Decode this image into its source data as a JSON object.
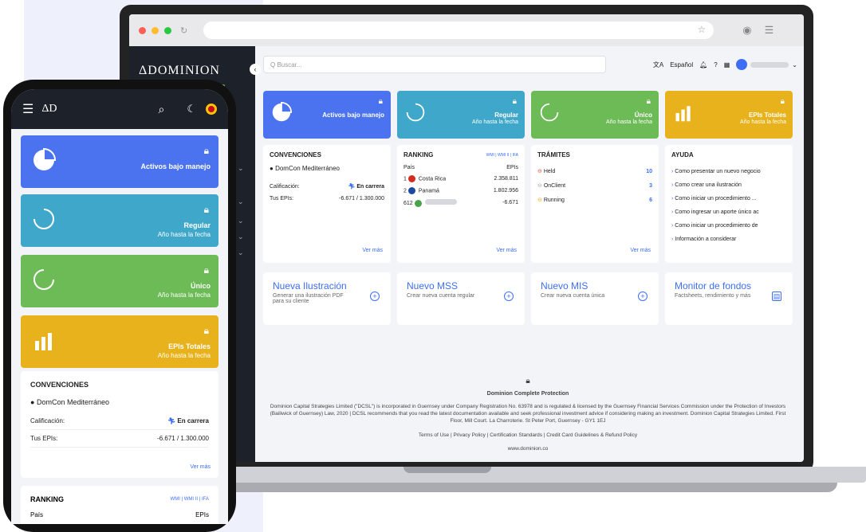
{
  "app": {
    "logo": "ΔDOMINION",
    "phone_logo": "ΔD"
  },
  "search": {
    "placeholder": "Q Buscar..."
  },
  "topbar": {
    "language": "Español"
  },
  "kpis": [
    {
      "title": "Activos bajo manejo",
      "subtitle": "",
      "color": "#4b73f0"
    },
    {
      "title": "Regular",
      "subtitle": "Año hasta la fecha",
      "color": "#3fa7c9"
    },
    {
      "title": "Único",
      "subtitle": "Año hasta la fecha",
      "color": "#6dbb57"
    },
    {
      "title": "EPIs Totales",
      "subtitle": "Año hasta la fecha",
      "color": "#e8b21c"
    }
  ],
  "convenciones": {
    "title": "CONVENCIONES",
    "name": "DomCon Mediterráneo",
    "calificacion_label": "Calificación:",
    "calificacion_value": "En carrera",
    "epis_label": "Tus EPIs:",
    "epis_value": "-6.671 / 1.300.000",
    "ver_mas": "Ver más"
  },
  "ranking": {
    "title": "RANKING",
    "tabs": "WMI | WMI II | IFA",
    "col_pais": "País",
    "col_epis": "EPIs",
    "rows": [
      {
        "rank": "1",
        "country": "Costa Rica",
        "value": "2.358.811"
      },
      {
        "rank": "2",
        "country": "Panamá",
        "value": "1.802.956"
      },
      {
        "rank": "612",
        "country": "",
        "value": "-6.671"
      }
    ],
    "ver_mas": "Ver más"
  },
  "tramites": {
    "title": "TRÁMITES",
    "rows": [
      {
        "label": "Held",
        "count": "10"
      },
      {
        "label": "OnClient",
        "count": "3"
      },
      {
        "label": "Running",
        "count": "6"
      }
    ],
    "ver_mas": "Ver más"
  },
  "ayuda": {
    "title": "AYUDA",
    "items": [
      "Como presentar un nuevo negocio",
      "Como crear una ilustración",
      "Como iniciar un procedimiento ...",
      "Como ingresar un aporte único ac",
      "Como iniciar un procedimiento de",
      "Información a considerar"
    ]
  },
  "actions": [
    {
      "title": "Nueva Ilustración",
      "subtitle": "Generar una ilustración PDF para su cliente"
    },
    {
      "title": "Nuevo MSS",
      "subtitle": "Crear nueva cuenta regular"
    },
    {
      "title": "Nuevo MIS",
      "subtitle": "Crear nueva cuenta única"
    },
    {
      "title": "Monitor de fondos",
      "subtitle": "Factsheets, rendimiento y más"
    }
  ],
  "footer": {
    "title": "Dominion Complete Protection",
    "legal": "Dominion Capital Strategies Limited (\"DCSL\") is incorporated in Guernsey under Company Registration No. 63978 and is regulated & licensed by the Guernsey Financial Services Commission under the Protection of Investors (Bailiwick of Guernsey) Law, 2020 | DCSL recommends that you read the latest documentation available and seek professional investment advice if considering making an investment. Dominion Capital Strategies Limited. First Floor, Mill Court. La Charroterie. St Peter Port, Guernsey - GY1 1EJ",
    "links": "Terms of Use | Privacy Policy | Certification Standards | Credit Card Guidelines & Refund Policy",
    "website": "www.dominion.co"
  }
}
